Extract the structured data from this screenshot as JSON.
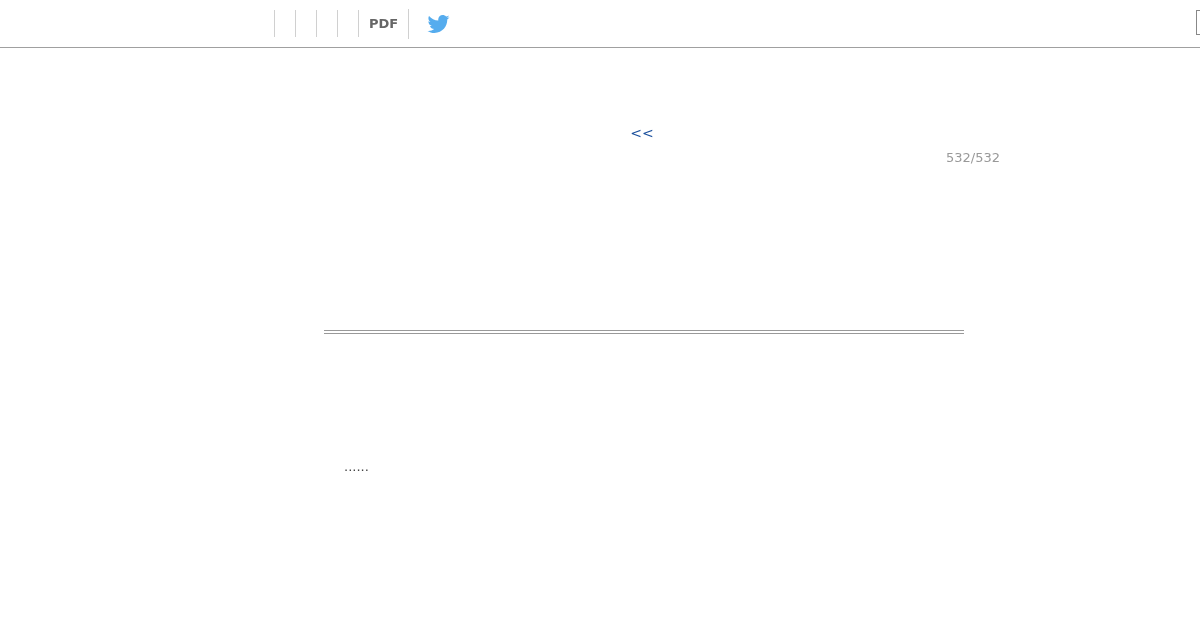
{
  "toolbar": {
    "pdf_label": "PDF"
  },
  "navigation": {
    "previous": "<<"
  },
  "page_counter": "532/532",
  "excerpt": "......"
}
